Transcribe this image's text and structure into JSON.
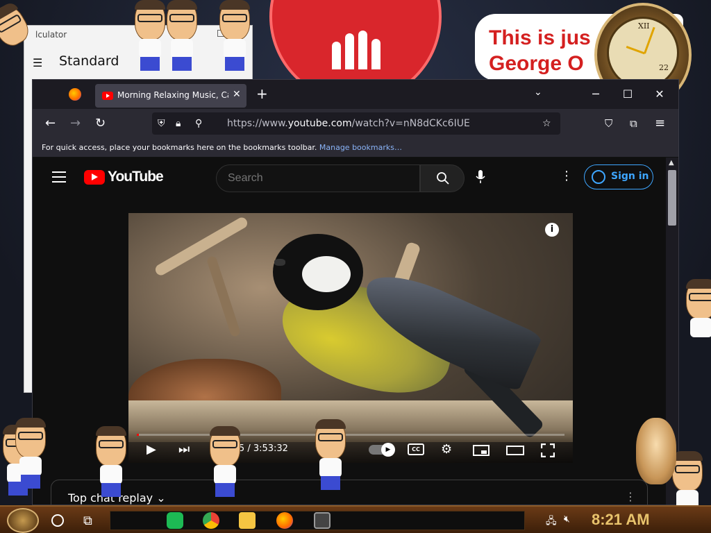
{
  "calculator": {
    "title": "lculator",
    "mode": "Standard",
    "menu_glyph": "☰"
  },
  "banner": {
    "text": "This is jus\nGeorge O"
  },
  "clock_widget": {
    "numeral": "XII",
    "date_label": "22"
  },
  "firefox": {
    "tab": {
      "title": "Morning Relaxing Music, Calm",
      "close": "✕"
    },
    "new_tab": "+",
    "tab_list": "⌄",
    "window_controls": {
      "minimize": "─",
      "maximize": "☐",
      "close": "✕"
    },
    "nav": {
      "back": "←",
      "forward": "→",
      "reload": "↻"
    },
    "url": {
      "prefix": "https://www.",
      "domain": "youtube.com",
      "path": "/watch?v=nN8dCKc6IUE"
    },
    "bookmarks": {
      "message": "For quick access, place your bookmarks here on the bookmarks toolbar.",
      "link": "Manage bookmarks…"
    }
  },
  "youtube": {
    "wordmark": "YouTube",
    "search_placeholder": "Search",
    "sign_in": "Sign in",
    "more": "⋮",
    "video": {
      "time": "0:15 / 3:53:32",
      "progress": 0.001
    },
    "chat": {
      "label": "Top chat replay",
      "chevron": "⌄",
      "more": "⋮"
    }
  },
  "taskbar": {
    "clock": "8:21 AM"
  },
  "colors": {
    "youtube_red": "#ff0000",
    "firefox_dark": "#1c1b22",
    "accent_blue": "#3ea6ff",
    "clock_gold": "#e8c36c"
  }
}
